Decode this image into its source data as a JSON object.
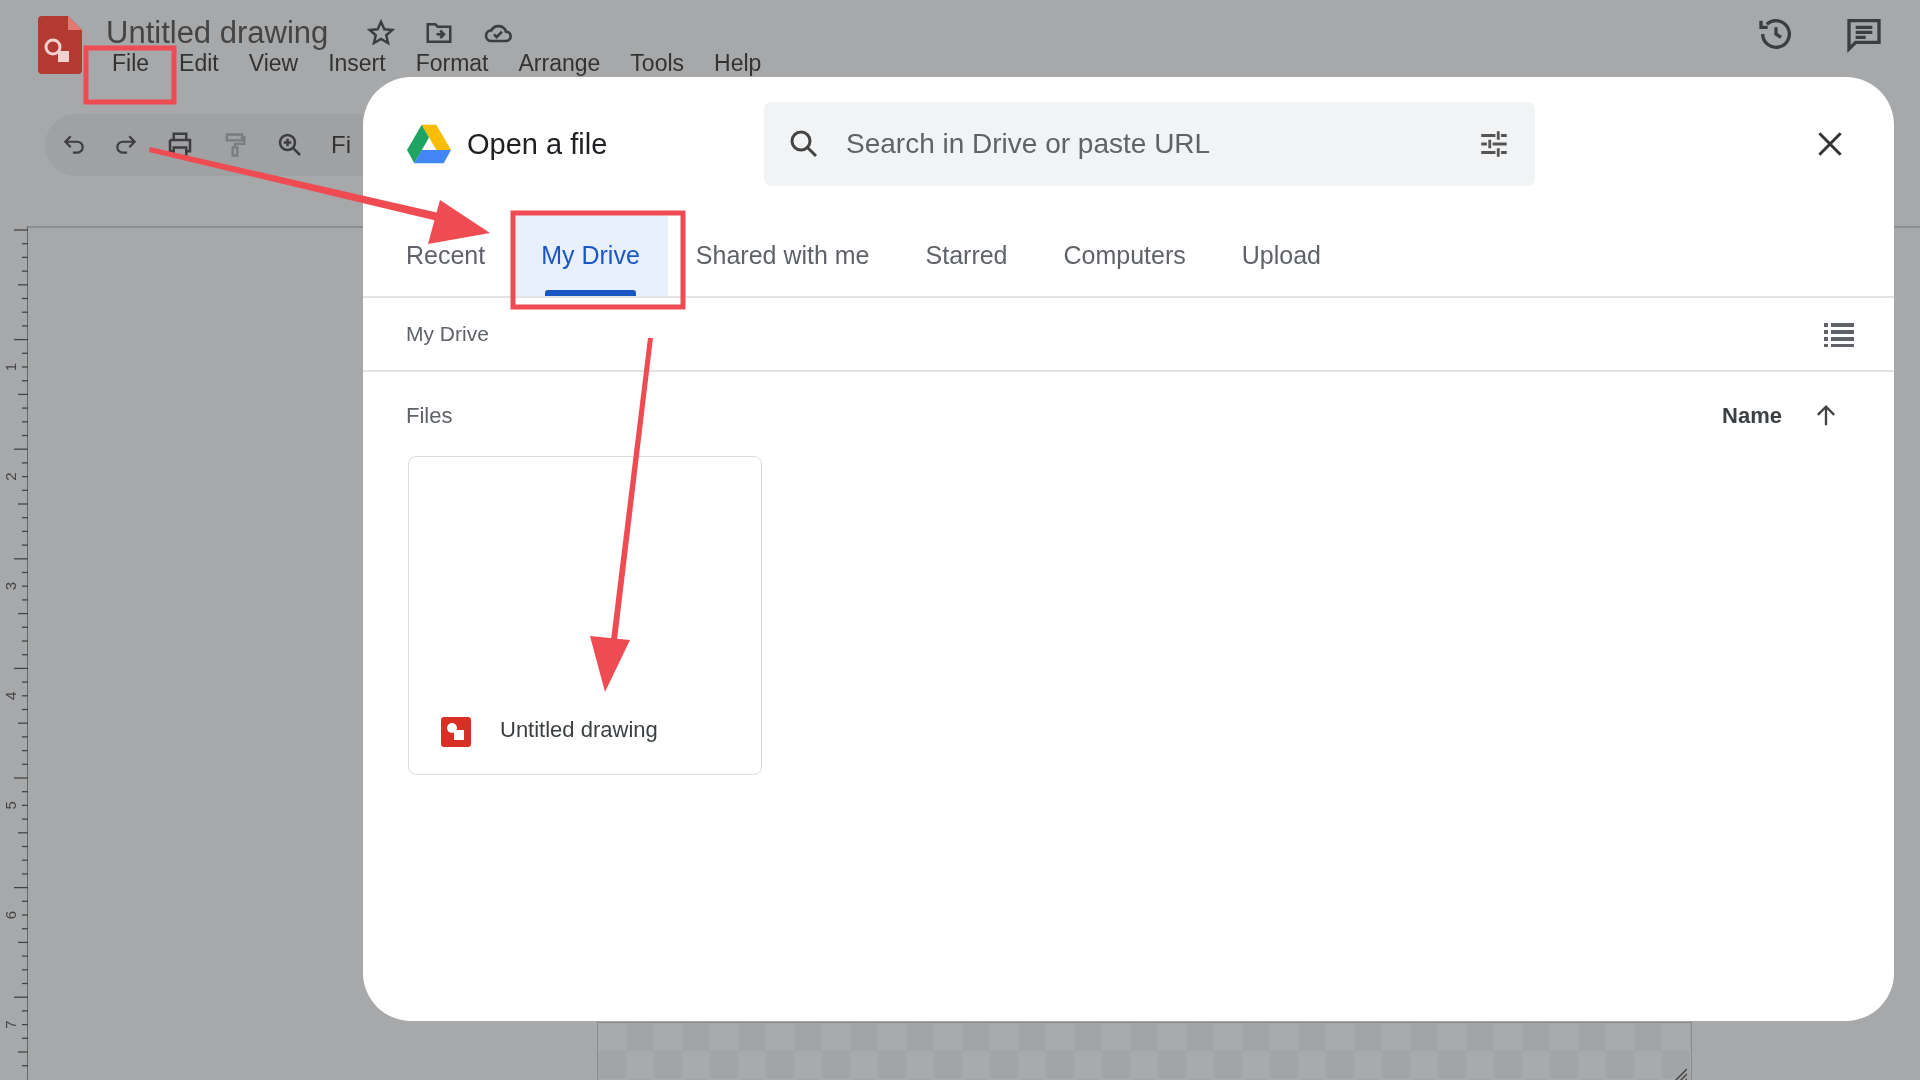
{
  "app": {
    "title": "Untitled drawing",
    "menu": [
      "File",
      "Edit",
      "View",
      "Insert",
      "Format",
      "Arrange",
      "Tools",
      "Help"
    ],
    "toolbar": {
      "zoom_label": "Fi"
    }
  },
  "ruler": {
    "marks": [
      "1",
      "2",
      "3",
      "4",
      "5",
      "6",
      "7"
    ]
  },
  "dialog": {
    "title": "Open a file",
    "search": {
      "placeholder": "Search in Drive or paste URL"
    },
    "tabs": [
      {
        "label": "Recent",
        "selected": false
      },
      {
        "label": "My Drive",
        "selected": true
      },
      {
        "label": "Shared with me",
        "selected": false
      },
      {
        "label": "Starred",
        "selected": false
      },
      {
        "label": "Computers",
        "selected": false
      },
      {
        "label": "Upload",
        "selected": false
      }
    ],
    "breadcrumb": "My Drive",
    "section": "Files",
    "sort": {
      "label": "Name"
    },
    "files": [
      {
        "name": "Untitled drawing"
      }
    ]
  }
}
